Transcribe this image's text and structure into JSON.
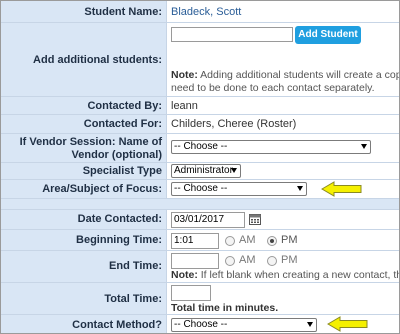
{
  "labels": {
    "student_name": "Student Name:",
    "add_students": "Add additional students:",
    "contacted_by": "Contacted By:",
    "contacted_for": "Contacted For:",
    "vendor_line1": "If Vendor Session: Name of",
    "vendor_line2": "Vendor (optional)",
    "specialist_type": "Specialist Type",
    "area_focus": "Area/Subject of Focus:",
    "date_contacted": "Date Contacted:",
    "beginning_time": "Beginning Time:",
    "end_time": "End Time:",
    "total_time": "Total Time:",
    "contact_method": "Contact Method?"
  },
  "values": {
    "student_name": "Bladeck, Scott",
    "add_student_button": "Add Student",
    "add_note_bold": "Note:",
    "add_note_line1": " Adding additional students will create a copy",
    "add_note_line2": "need to be done to each contact separately.",
    "contacted_by": "leann",
    "contacted_for": "Childers, Cheree (Roster)",
    "vendor_select": "-- Choose --",
    "specialist_select": "Administrator",
    "area_select": "-- Choose --",
    "date_contacted": "03/01/2017",
    "beginning_time": "1:01",
    "am": "AM",
    "pm": "PM",
    "end_time": "",
    "end_note_bold": "Note:",
    "end_note": " If left blank when creating a new contact, the",
    "total_time": "",
    "total_time_note": "Total time in minutes.",
    "contact_method_select": "-- Choose --"
  },
  "radios": {
    "beginning": "PM",
    "end": ""
  },
  "colors": {
    "label_bg": "#d9e6f5",
    "arrow": "#f5f000",
    "button": "#1f9fe0"
  }
}
